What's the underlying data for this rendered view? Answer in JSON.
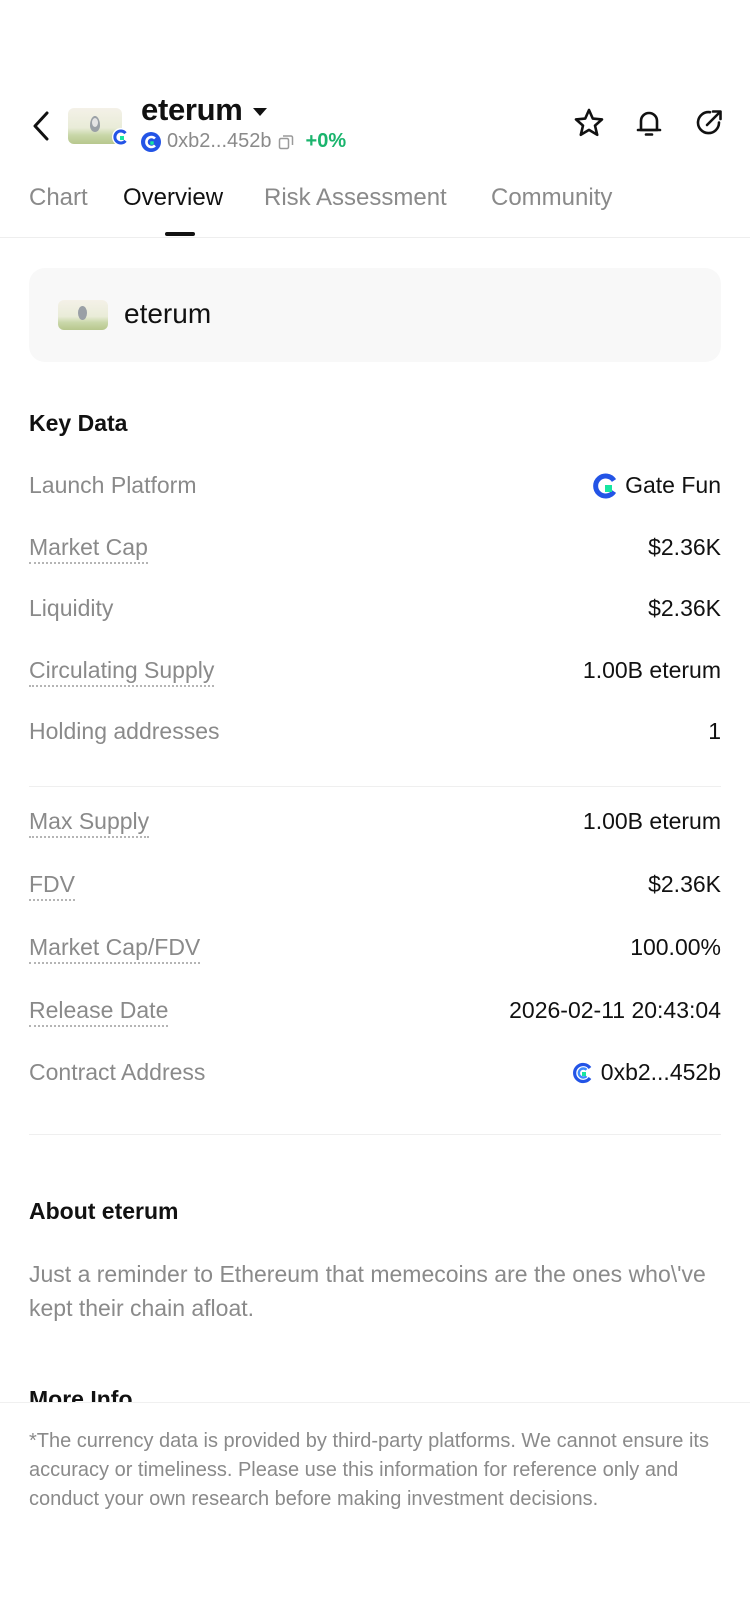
{
  "header": {
    "token_name": "eterum",
    "address": "0xb2...452b",
    "change": "+0%"
  },
  "tabs": [
    {
      "label": "Chart"
    },
    {
      "label": "Overview"
    },
    {
      "label": "Risk Assessment"
    },
    {
      "label": "Community"
    }
  ],
  "token_card": {
    "name": "eterum"
  },
  "key_data": {
    "title": "Key Data",
    "launch_platform": {
      "label": "Launch Platform",
      "value": "Gate Fun"
    },
    "market_cap": {
      "label": "Market Cap",
      "value": "$2.36K"
    },
    "liquidity": {
      "label": "Liquidity",
      "value": "$2.36K"
    },
    "circulating_supply": {
      "label": "Circulating Supply",
      "value": "1.00B eterum"
    },
    "holding_addresses": {
      "label": "Holding addresses",
      "value": "1"
    },
    "max_supply": {
      "label": "Max Supply",
      "value": "1.00B eterum"
    },
    "fdv": {
      "label": "FDV",
      "value": "$2.36K"
    },
    "mcap_fdv": {
      "label": "Market Cap/FDV",
      "value": "100.00%"
    },
    "release_date": {
      "label": "Release Date",
      "value": "2026-02-11 20:43:04"
    },
    "contract_address": {
      "label": "Contract Address",
      "value": "0xb2...452b"
    }
  },
  "about": {
    "title": "About eterum",
    "text": "Just a reminder to Ethereum that memecoins are the ones who\\'ve kept their chain afloat."
  },
  "more_info": {
    "title": "More Info"
  },
  "disclaimer": "*The currency data is provided by third-party platforms. We cannot ensure its accuracy or timeliness. Please use this information for reference only and conduct your own research before making investment decisions.",
  "colors": {
    "positive": "#1ab46d",
    "gate_blue": "#2354e6",
    "gate_cyan": "#17e6a1"
  }
}
